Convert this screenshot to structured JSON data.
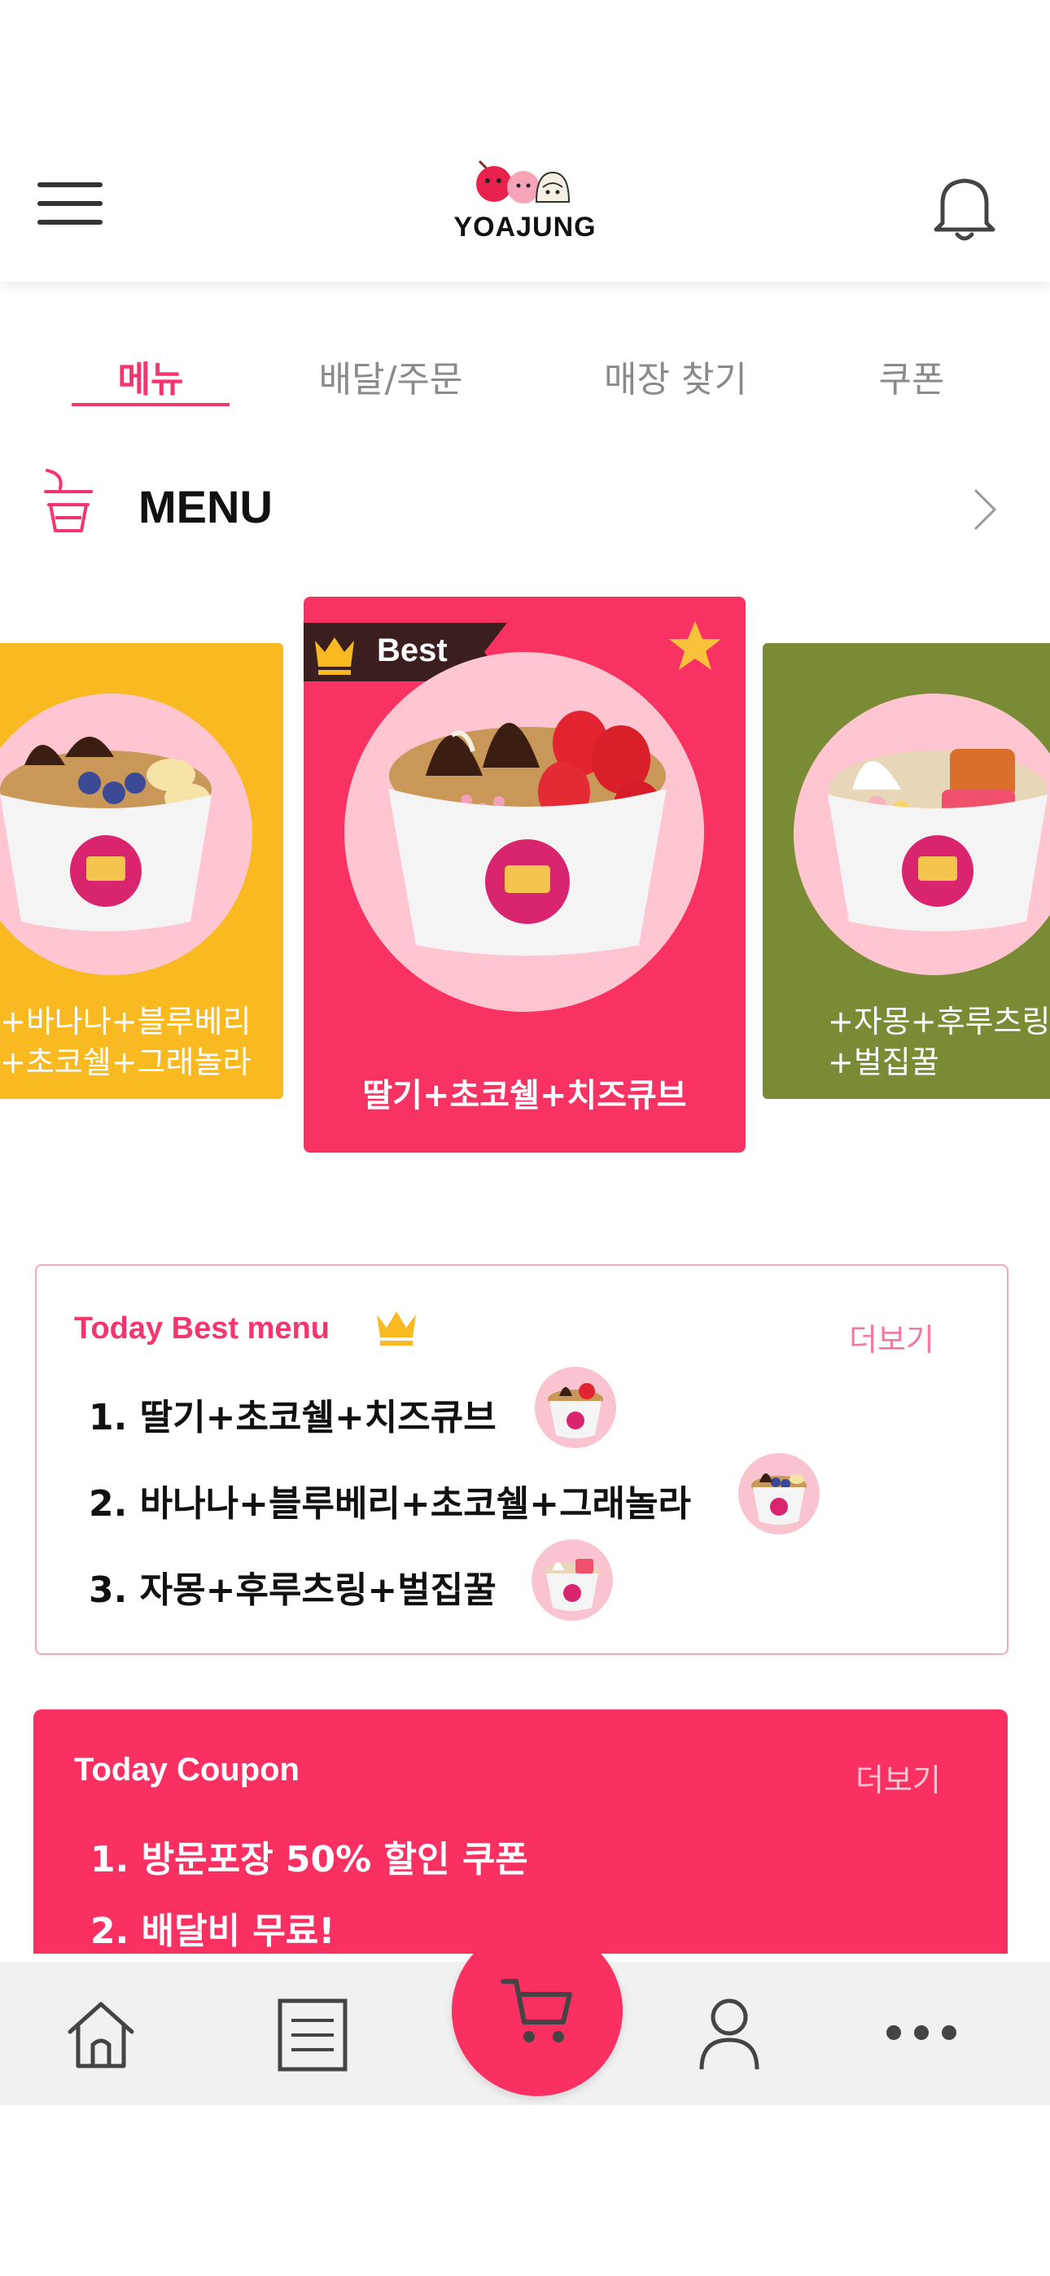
{
  "header": {
    "brand": "YOAJUNG",
    "menu_icon": "hamburger-icon",
    "notification_icon": "bell-icon"
  },
  "tabs": [
    {
      "label": "메뉴",
      "active": true
    },
    {
      "label": "배달/주문",
      "active": false
    },
    {
      "label": "매장 찾기",
      "active": false
    },
    {
      "label": "쿠폰",
      "active": false
    }
  ],
  "menu_section": {
    "title": "MENU",
    "icon": "yogurt-cup-icon",
    "arrow_icon": "chevron-right-icon"
  },
  "carousel": {
    "left": {
      "line1": "+바나나+블루베리",
      "line2": "+초코쉘+그래놀라",
      "bg": "#f8b921"
    },
    "center": {
      "badge": "Best",
      "title": "딸기+초코쉘+치즈큐브",
      "bg": "#f93264"
    },
    "right": {
      "line1": "+자몽+후루츠링",
      "line2": "+벌집꿀",
      "bg": "#7a8b35"
    }
  },
  "best_menu": {
    "title": "Today Best menu",
    "more": "더보기",
    "items": [
      {
        "rank": "1.",
        "name": "딸기+초코쉘+치즈큐브"
      },
      {
        "rank": "2.",
        "name": "바나나+블루베리+초코쉘+그래놀라"
      },
      {
        "rank": "3.",
        "name": "자몽+후루츠링+벌집꿀"
      }
    ]
  },
  "coupon": {
    "title": "Today Coupon",
    "more": "더보기",
    "items": [
      {
        "rank": "1.",
        "name": "방문포장 50% 할인 쿠폰"
      },
      {
        "rank": "2.",
        "name": "배달비 무료!"
      }
    ]
  },
  "bottom_nav": {
    "items": [
      "home-icon",
      "list-icon",
      "cart-icon",
      "user-icon",
      "more-icon"
    ]
  },
  "colors": {
    "accent": "#f5356e",
    "coupon_bg": "#fb3062"
  }
}
